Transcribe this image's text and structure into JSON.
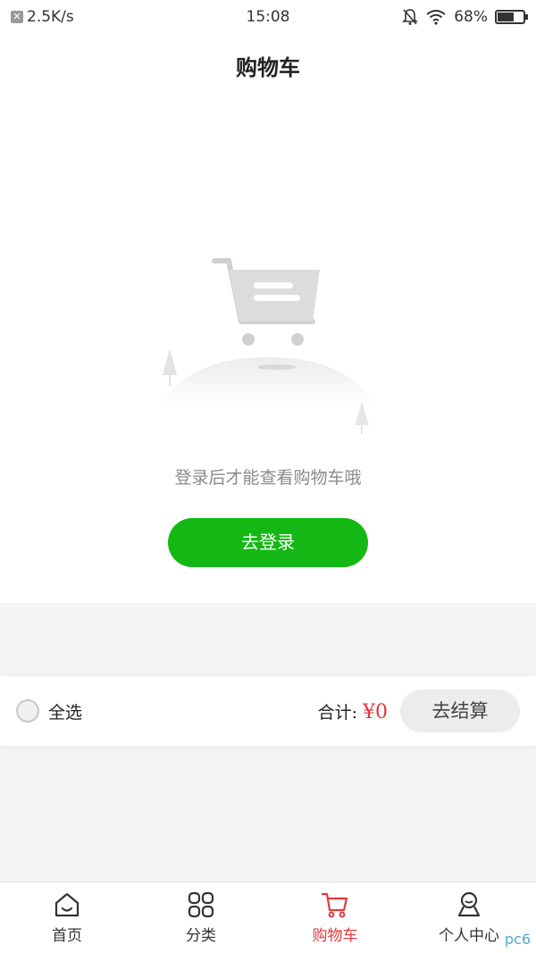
{
  "status_bar": {
    "net_speed": "2.5K/s",
    "time": "15:08",
    "battery": "68%",
    "battery_level": 0.68,
    "icons": [
      "notification-off-icon",
      "wifi-icon",
      "battery-icon"
    ]
  },
  "header": {
    "title": "购物车"
  },
  "empty_state": {
    "message": "登录后才能查看购物车哦",
    "login_button": "去登录"
  },
  "checkout_bar": {
    "select_all_label": "全选",
    "total_label": "合计:",
    "total_price": "¥0",
    "checkout_button": "去结算"
  },
  "tab_bar": {
    "items": [
      {
        "label": "首页",
        "icon": "home-icon",
        "active": false
      },
      {
        "label": "分类",
        "icon": "category-icon",
        "active": false
      },
      {
        "label": "购物车",
        "icon": "cart-icon",
        "active": true
      },
      {
        "label": "个人中心",
        "icon": "profile-icon",
        "active": false
      }
    ]
  },
  "watermark": "pc6",
  "colors": {
    "accent_green": "#14b814",
    "active_red": "#e0393e",
    "grey_bg": "#f4f4f4"
  }
}
